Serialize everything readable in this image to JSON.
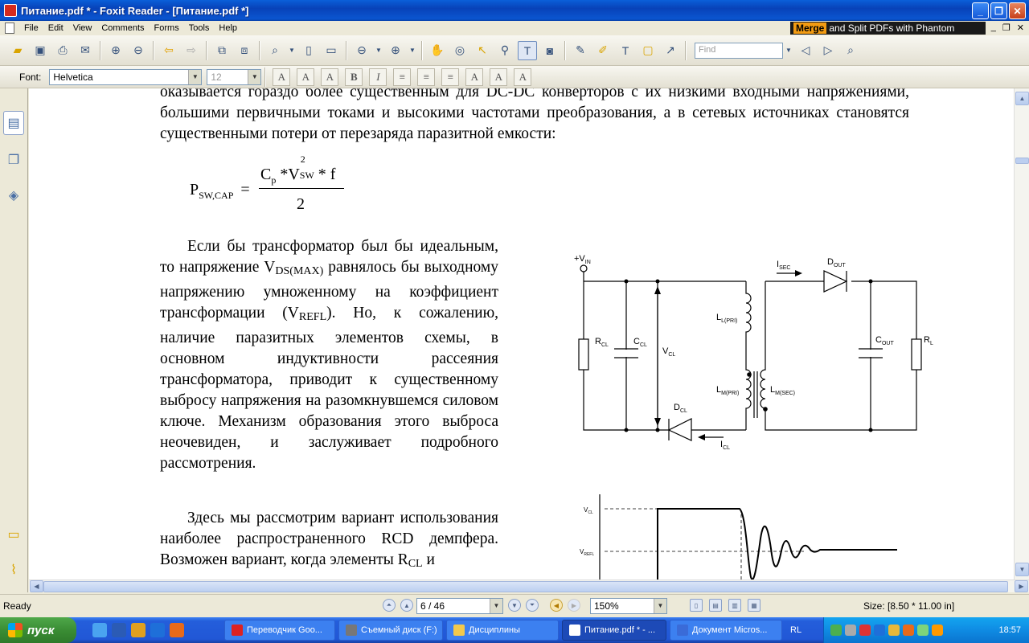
{
  "window": {
    "title": "Питание.pdf * - Foxit Reader - [Питание.pdf *]",
    "minimize": "_",
    "maximize": "❐",
    "close": "✕"
  },
  "menu": {
    "items": [
      "File",
      "Edit",
      "View",
      "Comments",
      "Forms",
      "Tools",
      "Help"
    ],
    "promo_highlight": "Merge",
    "promo_text": "and Split PDFs with Phantom",
    "mdi": [
      "_",
      "❐",
      "✕"
    ]
  },
  "toolbar": {
    "find_placeholder": "Find"
  },
  "format_bar": {
    "font_label": "Font:",
    "font_value": "Helvetica",
    "size_value": "12",
    "buttons": [
      "A",
      "A",
      "A",
      "B",
      "I",
      "≡",
      "≡",
      "≡",
      "A",
      "A",
      "A"
    ]
  },
  "document": {
    "paragraph1": "оказывается гораздо более существенным для DC-DC конверторов с их низкими входными напряжениями, большими первичными токами и высокими частотами преобразования, а в сетевых источниках становятся существенными потери от перезаряда паразитной емкости:",
    "formula": {
      "lhs": "P",
      "lhs_sub": "SW,CAP",
      "eq": "=",
      "num_c": "C",
      "num_c_sub": "p",
      "star": "*",
      "num_v": "V",
      "num_v_sup": "2",
      "num_v_sub": "SW",
      "num_f": "* f",
      "den": "2"
    },
    "paragraph2_a": "Если бы трансформатор был бы идеальным, то напряжение V",
    "paragraph2_sub1": "DS(MAX)",
    "paragraph2_b": " равнялось бы выходному напряжению умноженному на коэффициент трансформации (V",
    "paragraph2_sub2": "REFL",
    "paragraph2_c": "). Но, к сожалению, наличие паразитных элементов схемы, в основном индуктивности рассеяния трансформатора, приводит к существенному выбросу напряжения на разомкнувшемся силовом ключе. Механизм образования этого выброса неочевиден, и заслуживает подробного рассмотрения.",
    "paragraph3_a": "Здесь мы рассмотрим вариант использования наиболее распространенного RCD демпфера. Возможен вариант, когда элементы R",
    "paragraph3_sub": "CL",
    "paragraph3_b": " и"
  },
  "circuit": {
    "vin": "+V",
    "vin_sub": "IN",
    "isec": "I",
    "isec_sub": "SEC",
    "dout": "D",
    "dout_sub": "OUT",
    "rcl": "R",
    "rcl_sub": "CL",
    "ccl": "C",
    "ccl_sub": "CL",
    "vcl": "V",
    "vcl_sub": "CL",
    "lpri": "L",
    "lpri_sub": "L(PRI)",
    "lmpri": "L",
    "lmpri_sub": "M(PRI)",
    "lmsec": "L",
    "lmsec_sub": "M(SEC)",
    "cout": "C",
    "cout_sub": "OUT",
    "rl": "R",
    "rl_sub": "L",
    "dcl": "D",
    "dcl_sub": "CL",
    "icl": "I",
    "icl_sub": "CL"
  },
  "waveform": {
    "vcl": "V",
    "vcl_sub": "CL",
    "vrefl": "V",
    "vrefl_sub": "REFL"
  },
  "status": {
    "ready": "Ready",
    "page": "6 / 46",
    "zoom": "150%",
    "size": "Size: [8.50 * 11.00 in]"
  },
  "taskbar": {
    "start": "пуск",
    "tasks": [
      {
        "label": "Переводчик Goo...",
        "color": "#d22"
      },
      {
        "label": "Съемный диск (F:)",
        "color": "#777"
      },
      {
        "label": "Дисциплины",
        "color": "#f2c94c"
      },
      {
        "label": "Питание.pdf * - ...",
        "color": "#fff"
      },
      {
        "label": "Документ Micros...",
        "color": "#3a6bd8"
      }
    ],
    "lang": "RL",
    "clock": "18:57"
  }
}
